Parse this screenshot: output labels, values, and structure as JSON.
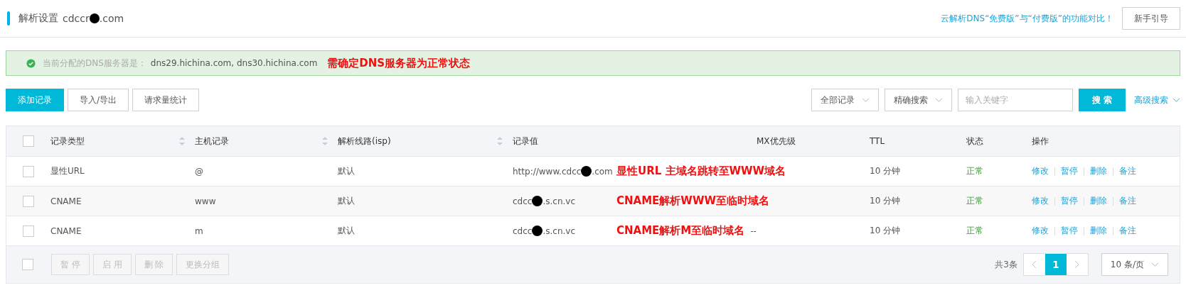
{
  "header": {
    "title": "解析设置",
    "domain_start": "cdccr",
    "domain_end": ".com",
    "compare_link": "云解析DNS“免费版”与“付费版”的功能对比！",
    "guide_button": "新手引导"
  },
  "alert": {
    "label": "当前分配的DNS服务器是：",
    "servers": "dns29.hichina.com, dns30.hichina.com",
    "note": "需确定DNS服务器为正常状态"
  },
  "toolbar": {
    "buttons": [
      {
        "label": "添加记录",
        "primary": true
      },
      {
        "label": "导入/导出",
        "primary": false
      },
      {
        "label": "请求量统计",
        "primary": false
      }
    ],
    "filters": [
      "全部记录",
      "精确搜索"
    ],
    "search": {
      "placeholder": "输入关键字"
    },
    "search_button": "搜 索",
    "advanced": "高级搜索"
  },
  "table": {
    "select_all_checked": false,
    "footer_select_all_checked": false,
    "columns": [
      {
        "label": "记录类型",
        "sortable": true
      },
      {
        "label": "主机记录",
        "sortable": true
      },
      {
        "label": "解析线路(isp)",
        "sortable": true
      },
      {
        "label": "记录值",
        "sortable": false
      },
      {
        "label": "MX优先级",
        "sortable": false
      },
      {
        "label": "TTL",
        "sortable": false
      },
      {
        "label": "状态",
        "sortable": false
      },
      {
        "label": "操作",
        "sortable": false
      }
    ],
    "rows": [
      {
        "checked": false,
        "type": "显性URL",
        "host": "@",
        "line": "默认",
        "value_start": "http://www.cdcc",
        "value_end": ".com",
        "note": "显性URL 主域名跳转至WWW域名",
        "ttl": "10 分钟",
        "status": "正常",
        "actions": [
          "修改",
          "暂停",
          "删除",
          "备注"
        ]
      },
      {
        "checked": false,
        "type": "CNAME",
        "host": "www",
        "line": "默认",
        "value_start": "cdcc",
        "value_end": ".s.cn.vc",
        "note": "CNAME解析WWW至临时域名",
        "ttl": "10 分钟",
        "status": "正常",
        "actions": [
          "修改",
          "暂停",
          "删除",
          "备注"
        ]
      },
      {
        "checked": false,
        "type": "CNAME",
        "host": "m",
        "line": "默认",
        "value_start": "cdcc",
        "value_end": ".s.cn.vc",
        "note": "CNAME解析M至临时域名",
        "mx": "--",
        "ttl": "10 分钟",
        "status": "正常",
        "actions": [
          "修改",
          "暂停",
          "删除",
          "备注"
        ]
      }
    ],
    "bulk_buttons": [
      {
        "label": "暂 停",
        "disabled": true
      },
      {
        "label": "启 用",
        "disabled": true
      },
      {
        "label": "删 除",
        "disabled": true
      },
      {
        "label": "更换分组",
        "disabled": true
      }
    ]
  },
  "pagination": {
    "total": "共3条",
    "pages": [
      {
        "label": "1",
        "selected": true
      }
    ],
    "page_size": "10 条/页"
  }
}
